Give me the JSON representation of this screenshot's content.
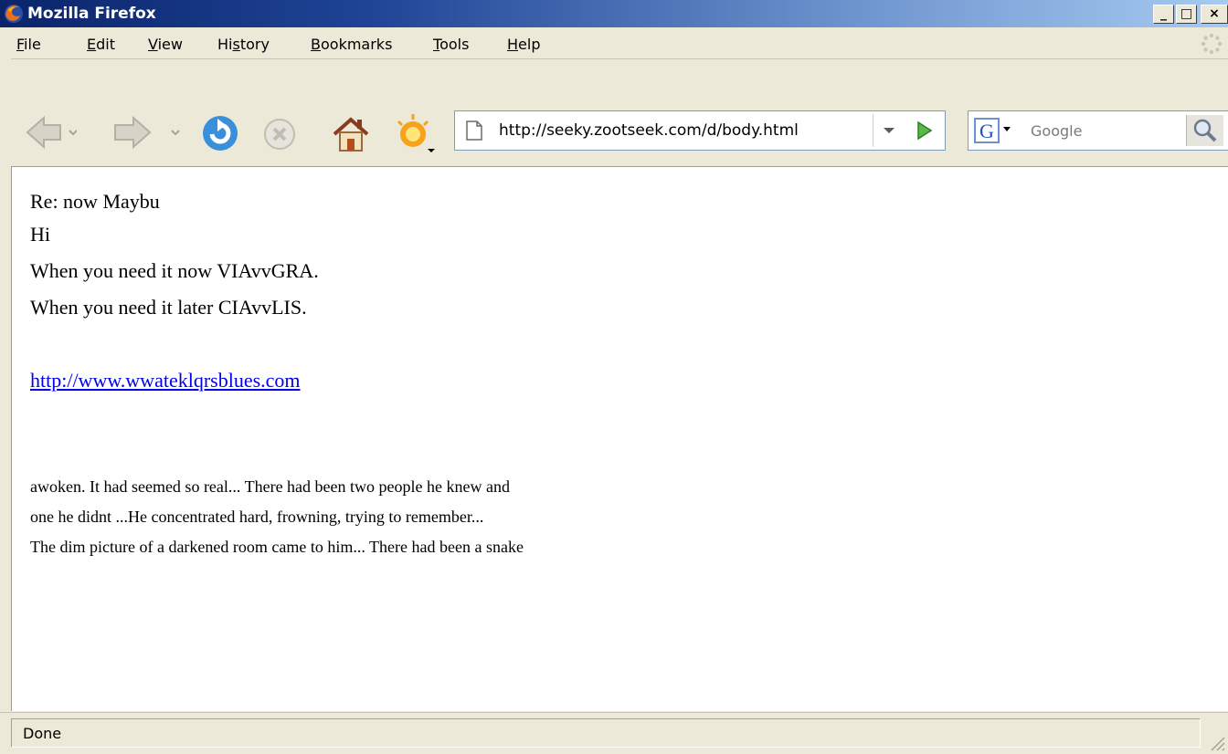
{
  "window": {
    "title": "Mozilla Firefox",
    "controls": {
      "minimize": "_",
      "maximize": "□",
      "close": "×"
    }
  },
  "menu": {
    "items": [
      {
        "label": "File",
        "accel": "F"
      },
      {
        "label": "Edit",
        "accel": "E"
      },
      {
        "label": "View",
        "accel": "V"
      },
      {
        "label": "History",
        "accel": "s"
      },
      {
        "label": "Bookmarks",
        "accel": "B"
      },
      {
        "label": "Tools",
        "accel": "T"
      },
      {
        "label": "Help",
        "accel": "H"
      }
    ]
  },
  "navbar": {
    "icons": [
      "back-arrow-icon",
      "forward-arrow-icon",
      "reload-icon",
      "stop-icon",
      "home-icon",
      "bookmark-star-icon"
    ],
    "url": "http://seeky.zootseek.com/d/body.html",
    "search_placeholder": "Google"
  },
  "content": {
    "subject": "Re: now Maybu",
    "greeting": "Hi",
    "line1": "When you need it now VIAvvGRA.",
    "line2": "When you need it later CIAvvLIS.",
    "link": "http://www.wwateklqrsblues.com",
    "para": [
      "awoken. It had seemed so real... There had been two people he knew and",
      "one he didnt ...He concentrated hard, frowning, trying to remember...",
      "The dim picture of a darkened room came to him... There had been a snake"
    ]
  },
  "status": {
    "text": "Done"
  },
  "colors": {
    "chrome": "#ece9d8",
    "title_dark": "#0a246a",
    "title_light": "#a6caf0",
    "link": "#0000ee"
  }
}
